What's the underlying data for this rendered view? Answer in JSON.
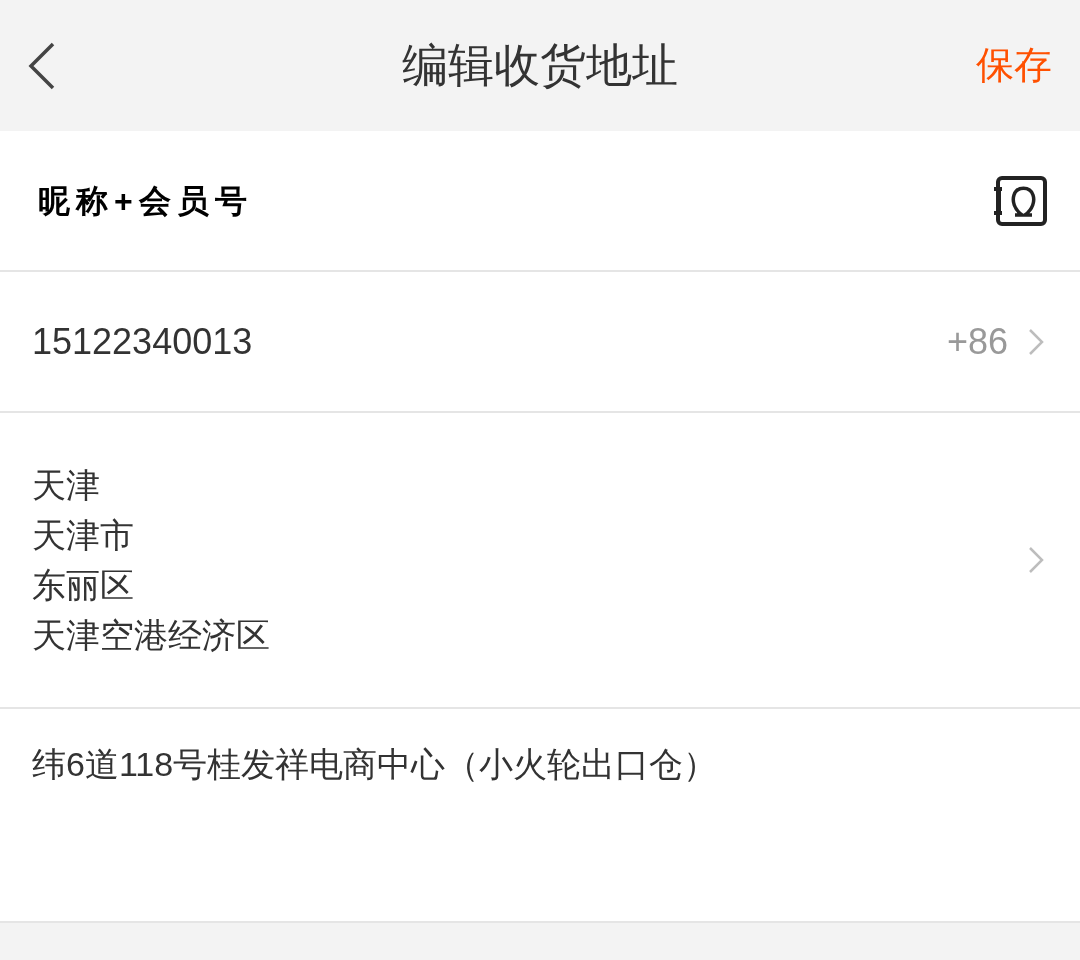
{
  "header": {
    "title": "编辑收货地址",
    "save": "保存"
  },
  "name": {
    "value": "昵称+会员号"
  },
  "phone": {
    "value": "15122340013",
    "country_code": "+86"
  },
  "region": {
    "lines": [
      "天津",
      "天津市",
      "东丽区",
      "天津空港经济区"
    ]
  },
  "address": {
    "value": "纬6道118号桂发祥电商中心（小火轮出口仓）"
  }
}
